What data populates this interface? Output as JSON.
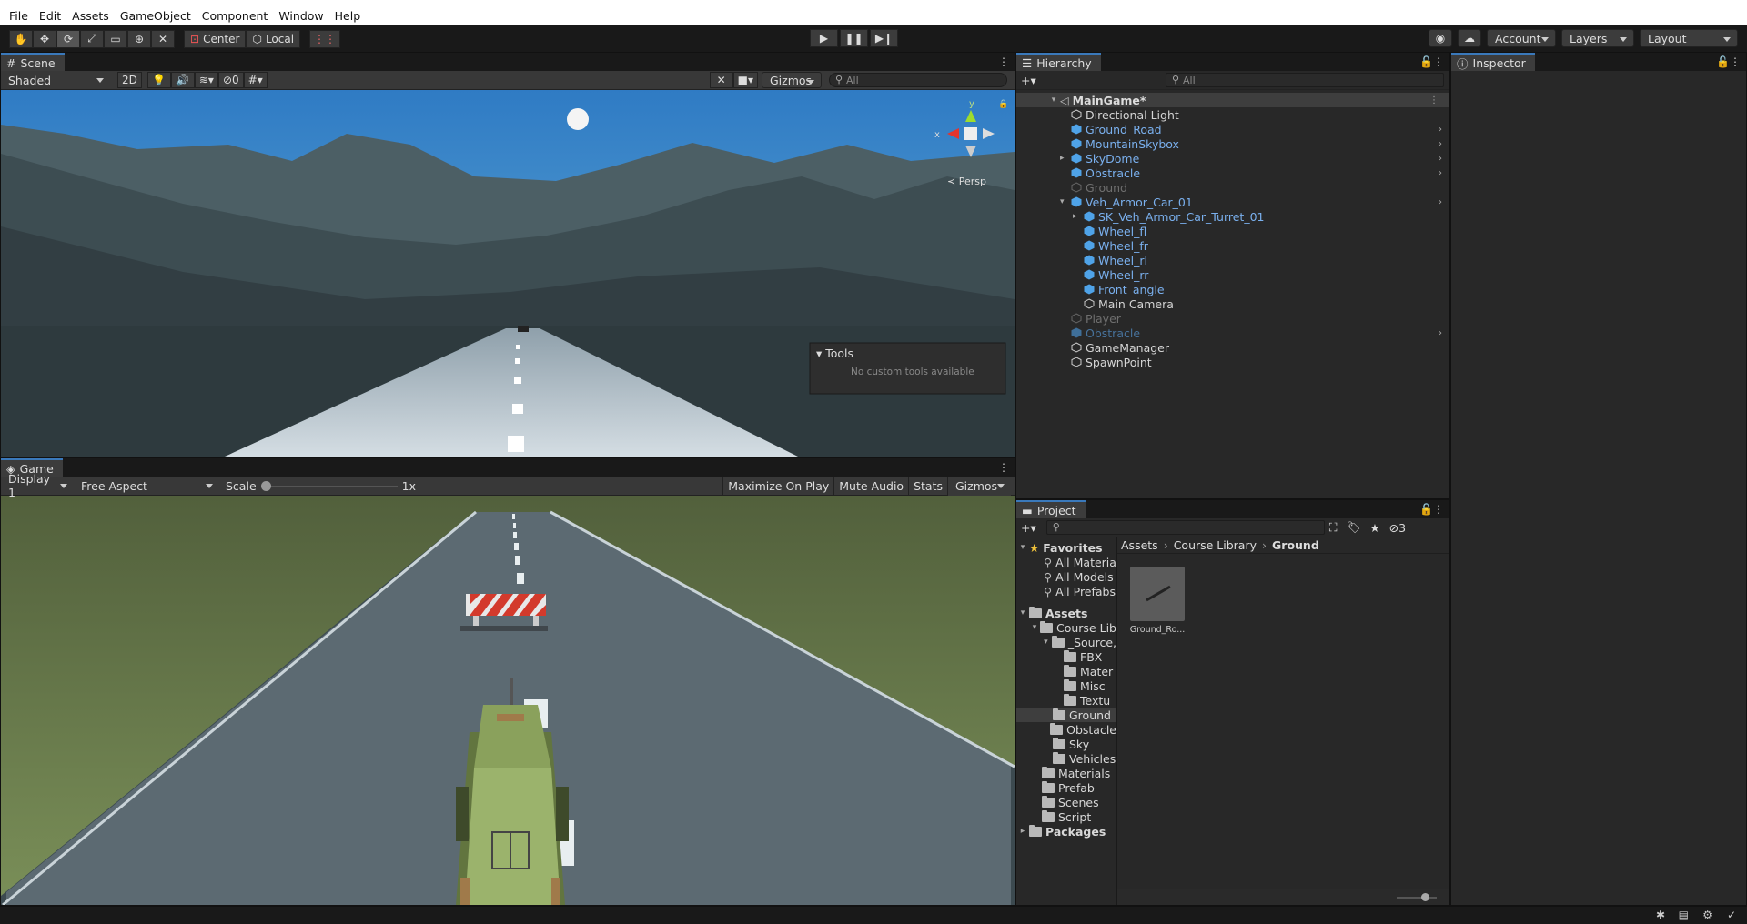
{
  "menu": [
    "File",
    "Edit",
    "Assets",
    "GameObject",
    "Component",
    "Window",
    "Help"
  ],
  "toolbar": {
    "pivot": "Center",
    "space": "Local",
    "account": "Account",
    "layers": "Layers",
    "layout": "Layout"
  },
  "scene": {
    "tab": "Scene",
    "shading": "Shaded",
    "mode_2d": "2D",
    "hidden_count": "0",
    "gizmos": "Gizmos",
    "search_placeholder": "All",
    "persp": "Persp",
    "axis_y": "y",
    "axis_x": "x",
    "tools_title": "Tools",
    "tools_msg": "No custom tools available"
  },
  "game": {
    "tab": "Game",
    "display": "Display 1",
    "aspect": "Free Aspect",
    "scale_label": "Scale",
    "scale_value": "1x",
    "maximize": "Maximize On Play",
    "mute": "Mute Audio",
    "stats": "Stats",
    "gizmos": "Gizmos"
  },
  "hierarchy": {
    "tab": "Hierarchy",
    "search_placeholder": "All",
    "scene_name": "MainGame*",
    "items": [
      {
        "label": "Directional Light",
        "style": "normal",
        "indent": 0
      },
      {
        "label": "Ground_Road",
        "style": "blue",
        "indent": 0
      },
      {
        "label": "MountainSkybox",
        "style": "blue",
        "indent": 0
      },
      {
        "label": "SkyDome",
        "style": "blue",
        "indent": 0
      },
      {
        "label": "Obstracle",
        "style": "blue",
        "indent": 0
      },
      {
        "label": "Ground",
        "style": "gray",
        "indent": 0
      },
      {
        "label": "Veh_Armor_Car_01",
        "style": "blue",
        "indent": 0
      },
      {
        "label": "SK_Veh_Armor_Car_Turret_01",
        "style": "blue",
        "indent": 1
      },
      {
        "label": "Wheel_fl",
        "style": "blue",
        "indent": 1
      },
      {
        "label": "Wheel_fr",
        "style": "blue",
        "indent": 1
      },
      {
        "label": "Wheel_rl",
        "style": "blue",
        "indent": 1
      },
      {
        "label": "Wheel_rr",
        "style": "blue",
        "indent": 1
      },
      {
        "label": "Front_angle",
        "style": "blue",
        "indent": 1
      },
      {
        "label": "Main Camera",
        "style": "normal",
        "indent": 1
      },
      {
        "label": "Player",
        "style": "gray",
        "indent": 0
      },
      {
        "label": "Obstracle",
        "style": "grayblue",
        "indent": 0
      },
      {
        "label": "GameManager",
        "style": "normal",
        "indent": 0
      },
      {
        "label": "SpawnPoint",
        "style": "normal",
        "indent": 0
      }
    ]
  },
  "inspector": {
    "tab": "Inspector"
  },
  "project": {
    "tab": "Project",
    "hidden_count": "3",
    "favorites_label": "Favorites",
    "favorites": [
      "All Materia",
      "All Models",
      "All Prefabs"
    ],
    "assets_label": "Assets",
    "tree": [
      {
        "label": "Course Lib",
        "level": 1
      },
      {
        "label": "_Source,",
        "level": 2
      },
      {
        "label": "FBX",
        "level": 3
      },
      {
        "label": "Mater",
        "level": 3
      },
      {
        "label": "Misc",
        "level": 3
      },
      {
        "label": "Textu",
        "level": 3
      },
      {
        "label": "Ground",
        "level": 2
      },
      {
        "label": "Obstacle",
        "level": 2
      },
      {
        "label": "Sky",
        "level": 2
      },
      {
        "label": "Vehicles",
        "level": 2
      },
      {
        "label": "Materials",
        "level": 1
      },
      {
        "label": "Prefab",
        "level": 1
      },
      {
        "label": "Scenes",
        "level": 1
      },
      {
        "label": "Script",
        "level": 1
      }
    ],
    "packages_label": "Packages",
    "breadcrumb": [
      "Assets",
      "Course Library",
      "Ground"
    ],
    "asset_name": "Ground_Ro..."
  }
}
